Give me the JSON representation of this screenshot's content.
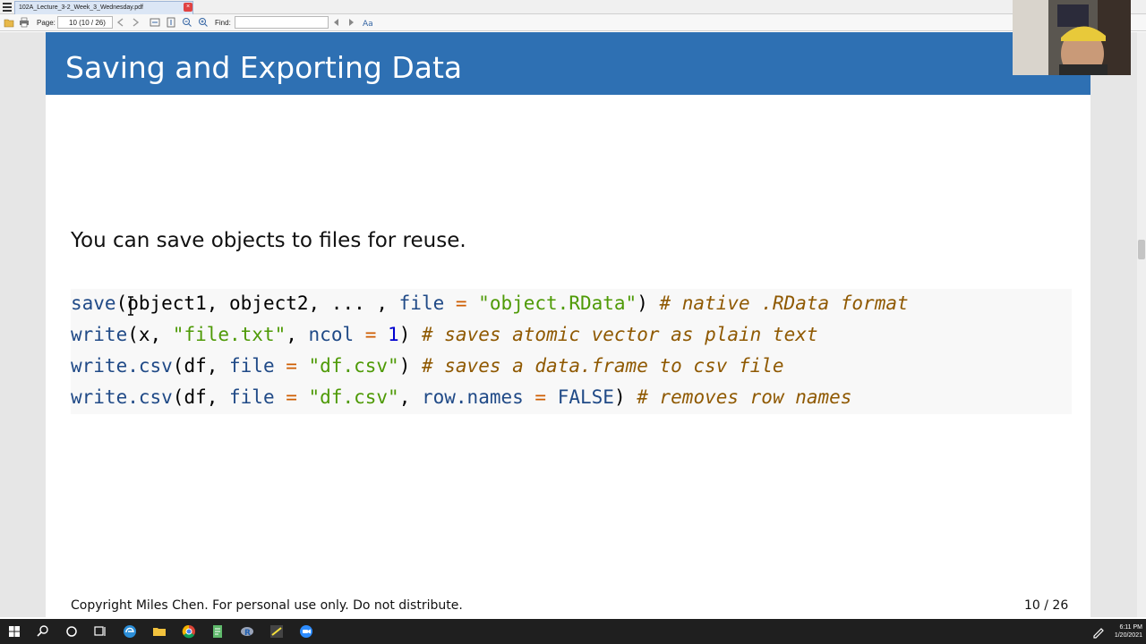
{
  "window": {
    "tab_title": "102A_Lecture_3-2_Week_3_Wednesday.pdf",
    "close_label": "×"
  },
  "toolbar": {
    "page_label": "Page:",
    "page_value": "10 (10 / 26)",
    "find_label": "Find:",
    "find_placeholder": ""
  },
  "slide": {
    "title": "Saving and Exporting Data",
    "intro": "You can save objects to files for reuse.",
    "code": [
      {
        "func": "save",
        "args": "(object1, object2, ... , ",
        "kw1": "file",
        "eq1": " = ",
        "str1": "\"object.RData\"",
        "close": ") ",
        "comment": "# native .RData format"
      },
      {
        "func": "write",
        "args": "(x, ",
        "str1": "\"file.txt\"",
        "mid": ", ",
        "kw1": "ncol",
        "eq1": " = ",
        "num1": "1",
        "close": ") ",
        "comment": "# saves atomic vector as plain text"
      },
      {
        "func": "write.csv",
        "args": "(df, ",
        "kw1": "file",
        "eq1": " = ",
        "str1": "\"df.csv\"",
        "close": ") ",
        "comment": "# saves a data.frame to csv file"
      },
      {
        "func": "write.csv",
        "args": "(df, ",
        "kw1": "file",
        "eq1": " = ",
        "str1": "\"df.csv\"",
        "mid": ", ",
        "kw2": "row.names",
        "eq2": " = ",
        "val2": "FALSE",
        "close": ") ",
        "comment": "# removes row names"
      }
    ],
    "footer_left": "Copyright Miles Chen. For personal use only. Do not distribute.",
    "footer_right": "10 / 26"
  },
  "taskbar": {
    "time": "6:11 PM",
    "date": "1/20/2021"
  },
  "colors": {
    "header_blue": "#2e70b3",
    "code_keyword": "#204a87",
    "code_string": "#4e9a06",
    "code_comment": "#8f5902",
    "code_operator": "#ce5c00"
  }
}
